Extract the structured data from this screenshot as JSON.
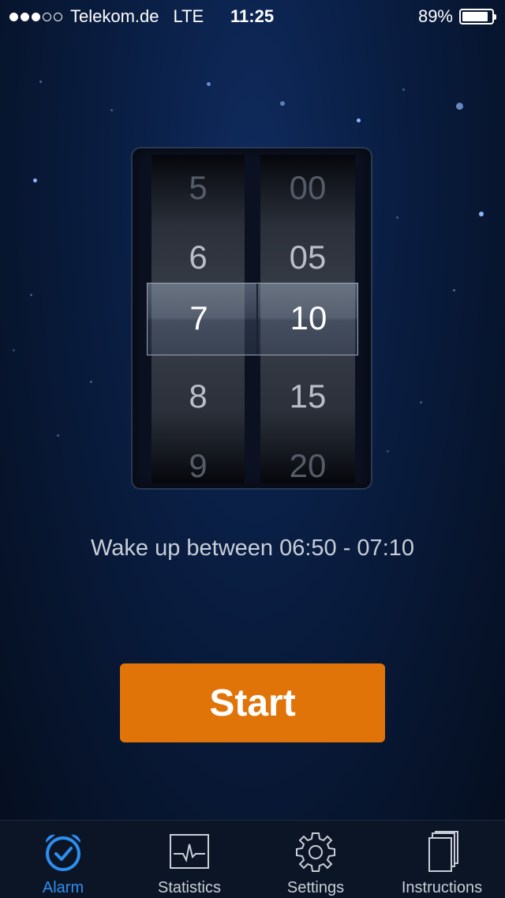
{
  "status_bar": {
    "carrier": "Telekom.de",
    "network": "LTE",
    "time": "11:25",
    "battery": "89%",
    "battery_level": 0.89,
    "signal_bars": 3
  },
  "picker": {
    "hours": [
      "5",
      "6",
      "7",
      "8",
      "9"
    ],
    "minutes": [
      "00",
      "05",
      "10",
      "15",
      "20"
    ],
    "selected_hour": "7",
    "selected_minute": "10"
  },
  "wake_text": "Wake up between 06:50 - 07:10",
  "start_label": "Start",
  "tabs": [
    {
      "label": "Alarm",
      "icon": "alarm-clock-icon",
      "active": true
    },
    {
      "label": "Statistics",
      "icon": "statistics-icon",
      "active": false
    },
    {
      "label": "Settings",
      "icon": "gear-icon",
      "active": false
    },
    {
      "label": "Instructions",
      "icon": "book-icon",
      "active": false
    }
  ],
  "colors": {
    "accent": "#2c8ff0",
    "start_button": "#e07408",
    "background": "#0a1f45"
  }
}
